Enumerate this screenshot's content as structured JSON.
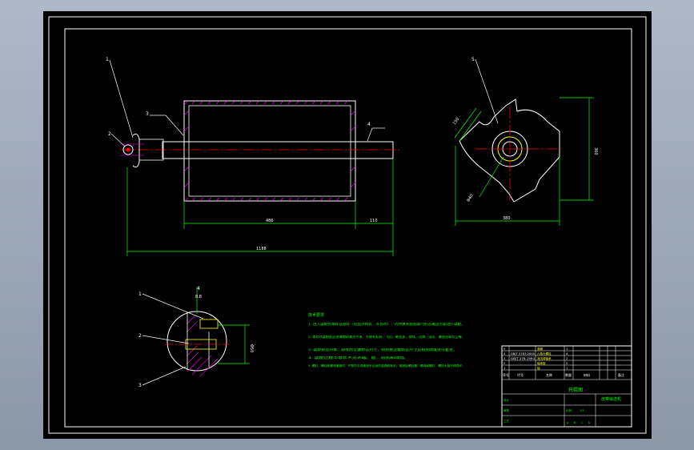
{
  "drawing": {
    "balloons": [
      "1",
      "2",
      "3",
      "4",
      "5",
      "1",
      "2",
      "3",
      "4",
      "1"
    ],
    "dimensions": {
      "drum_length": "486",
      "shaft_end": "110",
      "total_length": "1188",
      "side_a": "150",
      "side_h": "360",
      "side_w": "380",
      "diameter_label": "Φ40",
      "section_width": "8.8",
      "section_height": "Φ50"
    },
    "notes_title": "技术要求",
    "notes": [
      "1. 进入装配的零件及部件（包括外购件、外协件），均须具有检验部门的合格证方能进行装配。",
      "2. 零件在装配前必须清理和清洗干净，不得有毛刺、飞边、氧化皮、锈蚀、切屑、油污、着色剂和灰尘等。",
      "3. 装配前应对零、部件的主要配合尺寸，特别是过盈配合尺寸及相关精度进行复查。",
      "4. 装配过程中零件不允许磕、碰、划伤和锈蚀。",
      "5. 螺钉、螺栓和螺母紧固时，严禁打击或使用不合适的旋具和扳手。紧固后螺钉槽、螺母和螺钉、螺栓头部不得损坏。"
    ]
  },
  "title_block": {
    "parts": [
      {
        "no": "5",
        "code": "",
        "name": "滚筒",
        "qty": "1"
      },
      {
        "no": "4",
        "code": "GB/T 5783-2000",
        "name": "六角头螺栓",
        "qty": "4"
      },
      {
        "no": "3",
        "code": "GB/T 276-1994",
        "name": "深沟球轴承",
        "qty": "2"
      },
      {
        "no": "2",
        "code": "",
        "name": "轴承座",
        "qty": "2"
      },
      {
        "no": "1",
        "code": "",
        "name": "轴",
        "qty": "1"
      }
    ],
    "header": [
      "序号",
      "代号",
      "名称",
      "数量",
      "材料",
      "备注"
    ],
    "title": "托辊图",
    "drawing_name": "皮带输送机",
    "meta": [
      "设计",
      "审核",
      "工艺",
      "比例",
      "1:5"
    ],
    "scale_cells": [
      "A",
      "B",
      "C",
      "D"
    ]
  }
}
